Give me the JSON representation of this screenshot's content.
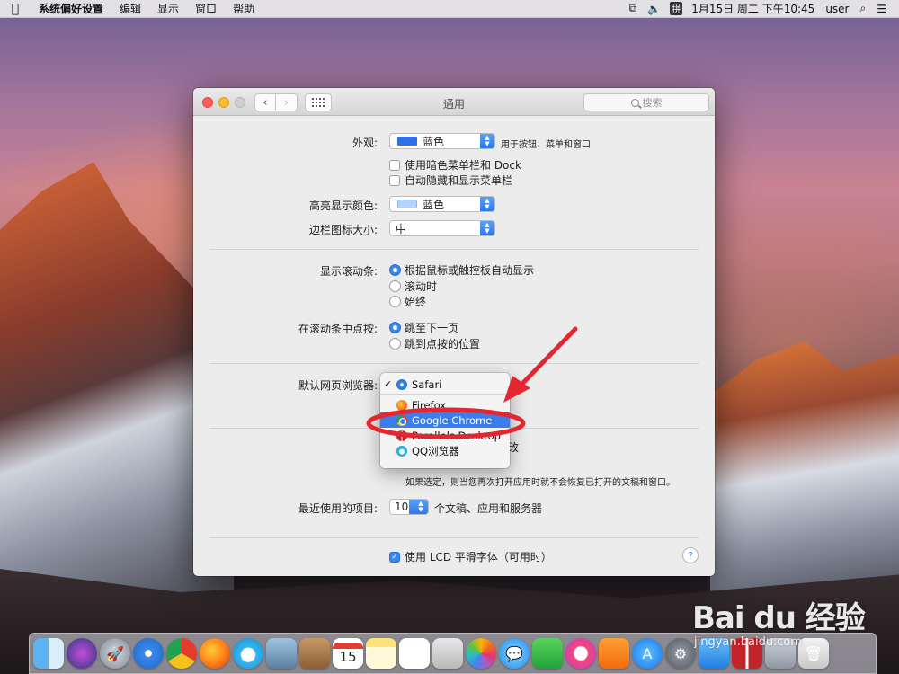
{
  "menubar": {
    "app": "系统偏好设置",
    "items": [
      "编辑",
      "显示",
      "窗口",
      "帮助"
    ],
    "clock": "1月15日 周二 下午10:45",
    "user": "user",
    "input_method": "拼"
  },
  "window": {
    "title": "通用",
    "search_placeholder": "搜索"
  },
  "appearance": {
    "label": "外观:",
    "value": "蓝色",
    "swatch_color": "#2f72e6",
    "hint": "用于按钮、菜单和窗口",
    "dark_menu": "使用暗色菜单栏和 Dock",
    "auto_hide": "自动隐藏和显示菜单栏"
  },
  "highlight": {
    "label": "高亮显示颜色:",
    "value": "蓝色",
    "swatch_color": "#b4d3f7"
  },
  "sidebar_icon": {
    "label": "边栏图标大小:",
    "value": "中"
  },
  "scroll_bars": {
    "label": "显示滚动条:",
    "options": [
      "根据鼠标或触控板自动显示",
      "滚动时",
      "始终"
    ],
    "selected": 0
  },
  "scroll_click": {
    "label": "在滚动条中点按:",
    "options": [
      "跳至下一页",
      "跳到点按的位置"
    ],
    "selected": 0
  },
  "browser": {
    "label": "默认网页浏览器:",
    "checkmark": "✓",
    "items": [
      "Safari",
      "Firefox",
      "Google Chrome",
      "Parallels Desktop",
      "QQ浏览器"
    ],
    "selected_index": 2,
    "behind_fragment": "改",
    "note": "如果选定，则当您再次打开应用时就不会恢复已打开的文稿和窗口。"
  },
  "recent": {
    "label": "最近使用的项目:",
    "value": "10",
    "suffix": "个文稿、应用和服务器"
  },
  "lcd": {
    "label": "使用 LCD 平滑字体（可用时）",
    "checked": true
  },
  "help_label": "?",
  "colors": {
    "accent": "#3b7ded",
    "annotation_red": "#e3262f"
  },
  "dock": {
    "items": [
      "finder-icon",
      "siri-icon",
      "launchpad-icon",
      "safari-icon",
      "chrome-icon",
      "firefox-icon",
      "qq-browser-icon",
      "preview-icon",
      "contacts-icon",
      "calendar-icon",
      "notes-icon",
      "reminders-icon",
      "photo-booth-icon",
      "photos-icon",
      "messages-icon",
      "facetime-icon",
      "music-icon",
      "books-icon",
      "app-store-icon",
      "system-preferences-icon",
      "mail-icon",
      "parallels-icon",
      "downloads-icon",
      "trash-icon"
    ],
    "calendar_day": "15"
  },
  "watermark": {
    "logo": "Bai du 经验",
    "url": "jingyan.baidu.com"
  }
}
